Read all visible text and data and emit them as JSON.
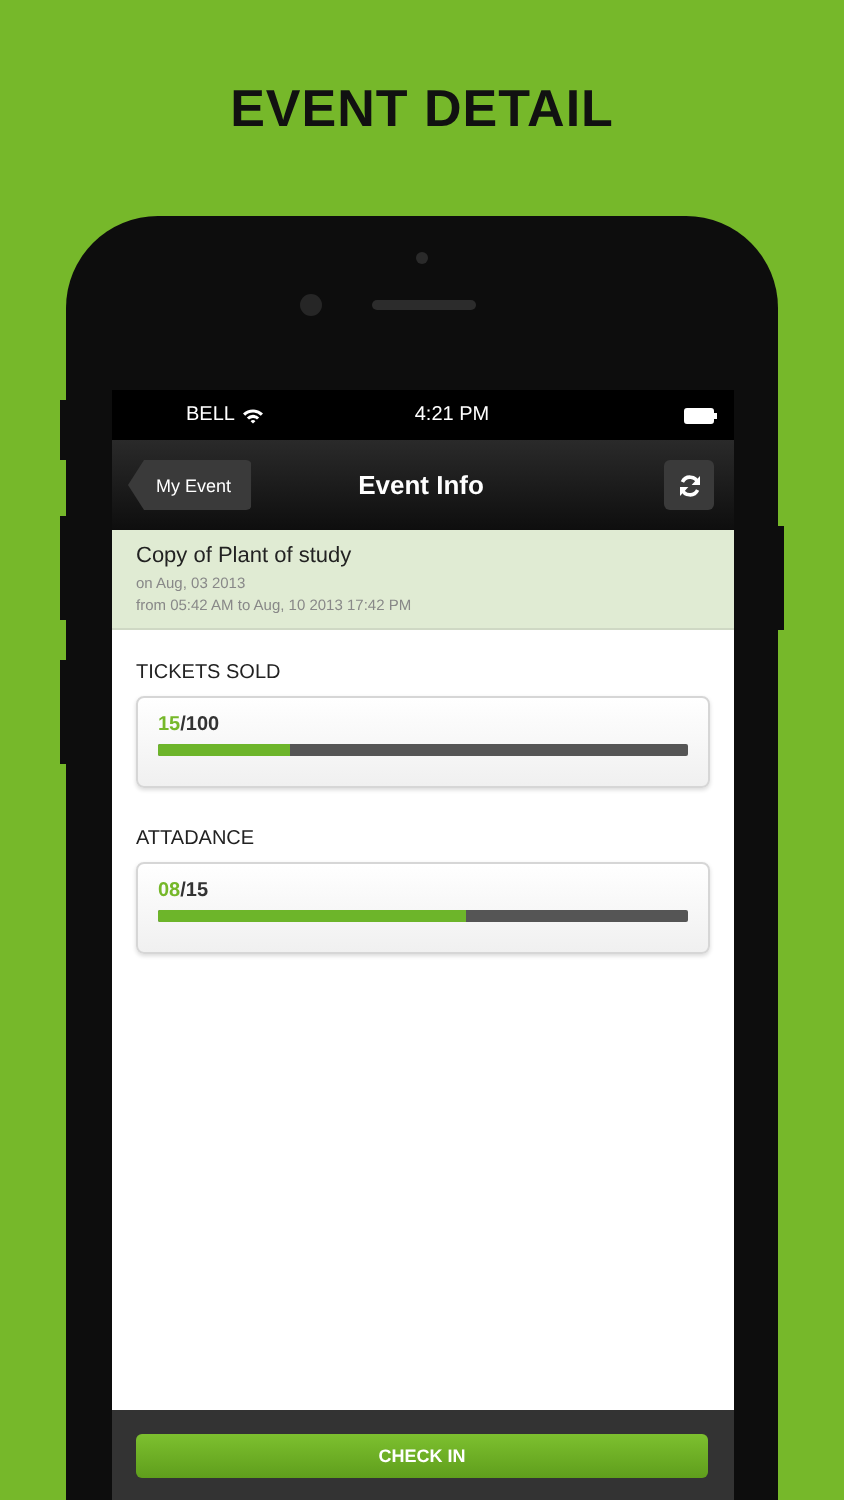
{
  "headline": "EVENT DETAIL",
  "status_bar": {
    "carrier": "BELL",
    "time": "4:21 PM"
  },
  "nav_bar": {
    "back_button": "My Event",
    "title": "Event Info"
  },
  "event": {
    "name": "Copy of Plant of study",
    "date": "on Aug, 03 2013",
    "range": "from 05:42 AM to Aug, 10 2013 17:42 PM"
  },
  "meters": [
    {
      "label": "TICKETS SOLD",
      "value": "15",
      "total": "/100",
      "level": 0.25
    },
    {
      "label": "ATTADANCE",
      "value": "08",
      "total": "/15",
      "level": 0.58
    }
  ],
  "action_button": "CHECK IN"
}
